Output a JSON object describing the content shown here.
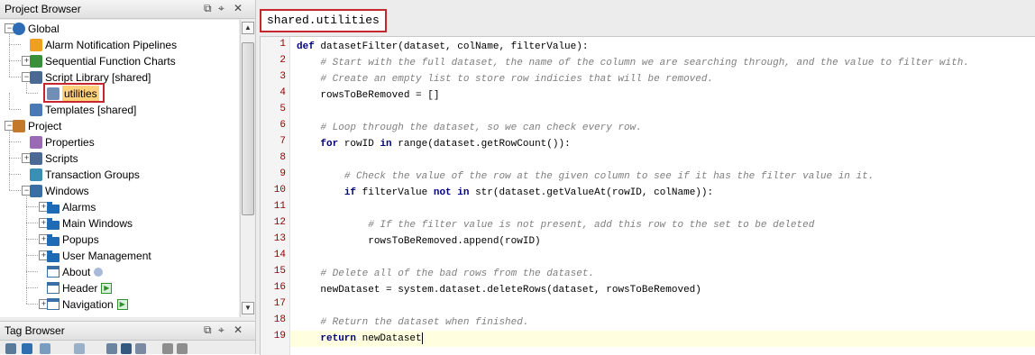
{
  "project_browser": {
    "title": "Project Browser",
    "controls": [
      "⧉",
      "⌖",
      "✕"
    ],
    "tree": [
      {
        "label": "Global",
        "depth": 0,
        "icon": "globe-icon",
        "expander": "−"
      },
      {
        "label": "Alarm Notification Pipelines",
        "depth": 1,
        "icon": "alarm-pipeline-icon"
      },
      {
        "label": "Sequential Function Charts",
        "depth": 1,
        "icon": "sfc-icon",
        "expander": "+"
      },
      {
        "label": "Script Library [shared]",
        "depth": 1,
        "icon": "script-library-icon",
        "expander": "−"
      },
      {
        "label": "utilities",
        "depth": 2,
        "icon": "script-file-icon",
        "selected": true
      },
      {
        "label": "Templates [shared]",
        "depth": 1,
        "icon": "templates-icon"
      },
      {
        "label": "Project",
        "depth": 0,
        "icon": "project-icon",
        "expander": "−"
      },
      {
        "label": "Properties",
        "depth": 1,
        "icon": "properties-icon"
      },
      {
        "label": "Scripts",
        "depth": 1,
        "icon": "scripts-icon",
        "expander": "+"
      },
      {
        "label": "Transaction Groups",
        "depth": 1,
        "icon": "transaction-groups-icon"
      },
      {
        "label": "Windows",
        "depth": 1,
        "icon": "windows-icon",
        "expander": "−"
      },
      {
        "label": "Alarms",
        "depth": 2,
        "icon": "folder-icon",
        "expander": "+"
      },
      {
        "label": "Main Windows",
        "depth": 2,
        "icon": "folder-icon",
        "expander": "+"
      },
      {
        "label": "Popups",
        "depth": 2,
        "icon": "folder-icon",
        "expander": "+"
      },
      {
        "label": "User Management",
        "depth": 2,
        "icon": "folder-icon",
        "expander": "+"
      },
      {
        "label": "About",
        "depth": 2,
        "icon": "window-icon",
        "badge": "info-badge-icon"
      },
      {
        "label": "Header",
        "depth": 2,
        "icon": "window-icon",
        "badge": "play-badge-icon"
      },
      {
        "label": "Navigation",
        "depth": 2,
        "icon": "window-icon",
        "badge": "play-badge-icon",
        "expander": "+"
      }
    ]
  },
  "tag_browser": {
    "title": "Tag Browser",
    "controls": [
      "⧉",
      "⌖",
      "✕"
    ]
  },
  "editor": {
    "tab_label": "shared.utilities",
    "current_line": 19,
    "lines": [
      "def datasetFilter(dataset, colName, filterValue):",
      "    # Start with the full dataset, the name of the column we are searching through, and the value to filter with.",
      "    # Create an empty list to store row indicies that will be removed.",
      "    rowsToBeRemoved = []",
      "",
      "    # Loop through the dataset, so we can check every row.",
      "    for rowID in range(dataset.getRowCount()):",
      "",
      "        # Check the value of the row at the given column to see if it has the filter value in it.",
      "        if filterValue not in str(dataset.getValueAt(rowID, colName)):",
      "",
      "            # If the filter value is not present, add this row to the set to be deleted",
      "            rowsToBeRemoved.append(rowID)",
      "",
      "    # Delete all of the bad rows from the dataset.",
      "    newDataset = system.dataset.deleteRows(dataset, rowsToBeRemoved)",
      "",
      "    # Return the dataset when finished.",
      "    return newDataset"
    ]
  },
  "colors": {
    "keyword": "#00007f",
    "comment": "#7f7f7f",
    "line_number": "#8f0000",
    "highlight_border": "#c8262e",
    "selected_bg": "#ffd27a",
    "current_line_bg": "#ffffe0"
  }
}
